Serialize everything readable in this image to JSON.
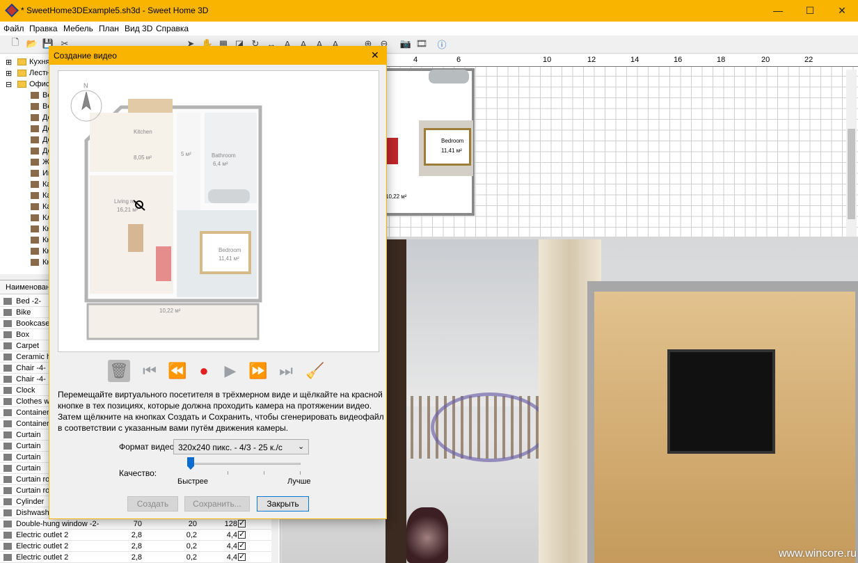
{
  "window": {
    "title": "* SweetHome3DExample5.sh3d - Sweet Home 3D",
    "controls": {
      "minimize": "—",
      "maximize": "☐",
      "close": "✕"
    }
  },
  "menu": [
    "Файл",
    "Правка",
    "Мебель",
    "План",
    "Вид 3D",
    "Справка"
  ],
  "toolbar": {
    "icons": [
      "new-icon",
      "open-icon",
      "save-icon",
      "preferences-icon",
      "undo-icon",
      "redo-icon",
      "cut-icon",
      "copy-icon",
      "paste-icon",
      "add-furniture-icon",
      "select-icon",
      "pan-icon",
      "create-walls-icon",
      "create-rooms-icon",
      "create-polylines-icon",
      "create-dimensions-icon",
      "add-text-icon",
      "text-style-icon",
      "text-increase-icon",
      "text-decrease-icon",
      "zoom-in-icon",
      "zoom-out-icon",
      "photo-icon",
      "video-icon",
      "help-icon"
    ]
  },
  "catalog_tree": [
    {
      "label": "Кухня",
      "type": "folder",
      "expanded": false
    },
    {
      "label": "Лестн",
      "type": "folder",
      "expanded": false
    },
    {
      "label": "Офис",
      "type": "folder",
      "expanded": true
    },
    {
      "label": "Be",
      "type": "item"
    },
    {
      "label": "Be",
      "type": "item"
    },
    {
      "label": "Де",
      "type": "item"
    },
    {
      "label": "Де",
      "type": "item"
    },
    {
      "label": "Де",
      "type": "item"
    },
    {
      "label": "До",
      "type": "item"
    },
    {
      "label": "Ж",
      "type": "item"
    },
    {
      "label": "Ин",
      "type": "item"
    },
    {
      "label": "Ка",
      "type": "item"
    },
    {
      "label": "Ка",
      "type": "item"
    },
    {
      "label": "Ка",
      "type": "item"
    },
    {
      "label": "Кл",
      "type": "item"
    },
    {
      "label": "Кн",
      "type": "item"
    },
    {
      "label": "Кн",
      "type": "item"
    },
    {
      "label": "Кн",
      "type": "item"
    },
    {
      "label": "Кн",
      "type": "item"
    }
  ],
  "furniture_table": {
    "header": "Наименован",
    "rows": [
      {
        "name": "Bed -2-"
      },
      {
        "name": "Bike"
      },
      {
        "name": "Bookcase"
      },
      {
        "name": "Box"
      },
      {
        "name": "Carpet"
      },
      {
        "name": "Ceramic h"
      },
      {
        "name": "Chair -4-"
      },
      {
        "name": "Chair -4-"
      },
      {
        "name": "Clock"
      },
      {
        "name": "Clothes w"
      },
      {
        "name": "Container"
      },
      {
        "name": "Container"
      },
      {
        "name": "Curtain"
      },
      {
        "name": "Curtain"
      },
      {
        "name": "Curtain"
      },
      {
        "name": "Curtain"
      },
      {
        "name": "Curtain ro"
      },
      {
        "name": "Curtain ro"
      },
      {
        "name": "Cylinder"
      },
      {
        "name": "Dishwashe"
      },
      {
        "name": "Double-hung window -2-",
        "w": "70",
        "d": "20",
        "h": "128",
        "visible": true
      },
      {
        "name": "Electric outlet 2",
        "w": "2,8",
        "d": "0,2",
        "h": "4,4",
        "visible": true
      },
      {
        "name": "Electric outlet 2",
        "w": "2,8",
        "d": "0,2",
        "h": "4,4",
        "visible": true
      },
      {
        "name": "Electric outlet 2",
        "w": "2,8",
        "d": "0,2",
        "h": "4,4",
        "visible": true
      }
    ]
  },
  "plan": {
    "ruler_labels": [
      "4",
      "6",
      "10",
      "12",
      "14",
      "16",
      "18",
      "20",
      "22"
    ],
    "rooms": [
      {
        "name": "Bedroom",
        "area": "11,41 м²"
      },
      {
        "area": "10,22 м²"
      }
    ]
  },
  "view3d": {
    "watermark": "www.wincore.ru"
  },
  "dialog": {
    "title": "Создание видео",
    "close": "✕",
    "preview_rooms": [
      {
        "name": "Kitchen",
        "area": "8,05 м²"
      },
      {
        "area": "5 м²"
      },
      {
        "name": "Bathroom",
        "area": "6,4 м²"
      },
      {
        "name": "Living ro",
        "area": "16,21 м²"
      },
      {
        "name": "Bedroom",
        "area": "11,41 м²"
      },
      {
        "area": "10,22 м²"
      }
    ],
    "compass": "N",
    "controls": [
      "delete-path-icon",
      "go-to-start-icon",
      "rewind-icon",
      "record-icon",
      "play-icon",
      "fast-forward-icon",
      "go-to-end-icon",
      "clear-icon"
    ],
    "description": "Перемещайте виртуального посетителя в трёхмерном виде и щёлкайте на красной кнопке в тех позициях, которые должна проходить камера на протяжении видео. Затем щёлкните на кнопках Создать и Сохранить, чтобы сгенерировать видеофайл в соответствии с указанным вами путём движения камеры.",
    "format_label": "Формат видео:",
    "format_value": "320x240 пикс. - 4/3 - 25 к./с",
    "quality_label": "Качество:",
    "quality_min": "Быстрее",
    "quality_max": "Лучше",
    "quality_level": 0,
    "buttons": {
      "create": "Создать",
      "save": "Сохранить...",
      "close": "Закрыть"
    }
  }
}
